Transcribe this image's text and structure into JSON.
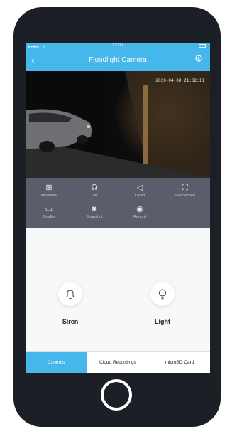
{
  "status_bar": {
    "carrier": "●●●●○ ᯤ",
    "time": "12:00"
  },
  "header": {
    "back_icon": "back-arrow-icon",
    "title": "Floodlight Camera",
    "settings_icon": "gear-icon"
  },
  "video": {
    "timestamp": "2020-04-09 21:32:11"
  },
  "controls": [
    {
      "icon": "multiview-icon",
      "glyph": "⊞",
      "label": "Multiview"
    },
    {
      "icon": "talk-icon",
      "glyph": "☊",
      "label": "Talk"
    },
    {
      "icon": "speaker-icon",
      "glyph": "◁",
      "label": "Listen"
    },
    {
      "icon": "fullscreen-icon",
      "glyph": "⛶",
      "label": "Full Screen"
    },
    {
      "icon": "quality-icon",
      "glyph": "▭",
      "label": "Quality"
    },
    {
      "icon": "snapshot-icon",
      "glyph": "◙",
      "label": "Snapshot"
    },
    {
      "icon": "record-icon",
      "glyph": "◉",
      "label": "Record"
    }
  ],
  "actions": {
    "siren": {
      "icon": "bell-icon",
      "label": "Siren"
    },
    "light": {
      "icon": "lightbulb-icon",
      "label": "Light"
    }
  },
  "tabs": [
    {
      "label": "Controls",
      "active": true
    },
    {
      "label": "Cloud Recordings",
      "active": false
    },
    {
      "label": "microSD Card",
      "active": false
    }
  ],
  "colors": {
    "accent": "#45b7ea",
    "controls_bg": "#5a5e6a",
    "phone_body": "#1c1f26"
  }
}
